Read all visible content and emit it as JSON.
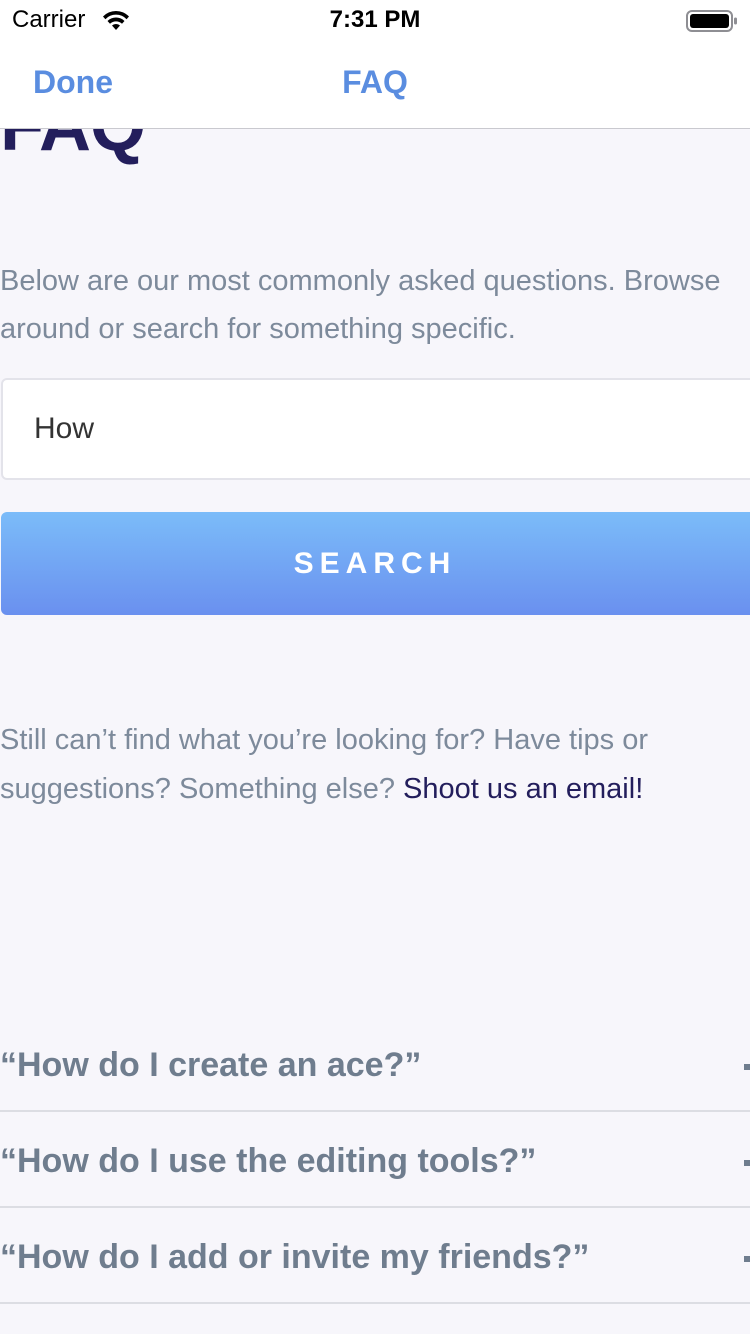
{
  "status_bar": {
    "carrier": "Carrier",
    "time": "7:31 PM",
    "wifi_icon": "wifi-icon",
    "battery_icon": "battery-icon"
  },
  "nav_bar": {
    "done_label": "Done",
    "title": "FAQ",
    "accent_color": "#5a8de0"
  },
  "main": {
    "heading": "FAQ",
    "intro": "Below are our most commonly asked questions. Browse around or search for something specific.",
    "search": {
      "value": "How",
      "button_label": "SEARCH"
    },
    "help": {
      "text": "Still can’t find what you’re looking for? Have tips or suggestions? Something else? ",
      "link_label": "Shoot us an email!"
    },
    "faq_items": [
      {
        "question": "“How do I create an ace?”",
        "icon": "expand-icon"
      },
      {
        "question": "“How do I use the editing tools?”",
        "icon": "expand-icon"
      },
      {
        "question": "“How do I add or invite my friends?”",
        "icon": "expand-icon"
      }
    ]
  }
}
